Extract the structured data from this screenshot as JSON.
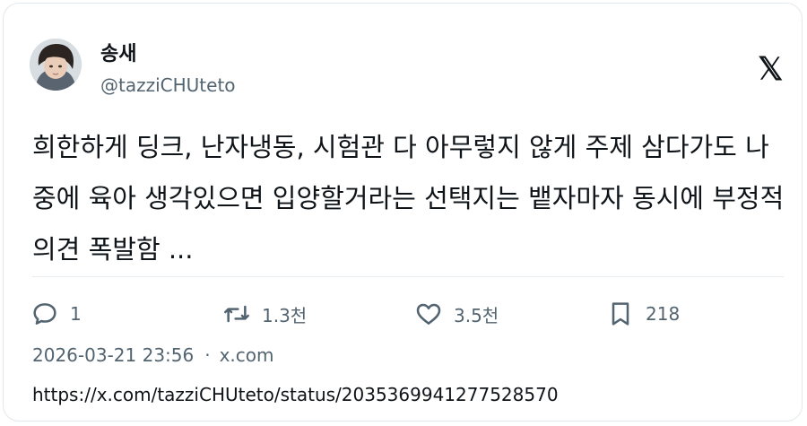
{
  "author": {
    "display_name": "송새",
    "handle": "@tazziCHUteto"
  },
  "tweet": {
    "text": "희한하게 딩크, 난자냉동, 시험관 다 아무렇지 않게 주제 삼다가도 나중에 육아 생각있으면 입양할거라는 선택지는 뱉자마자 동시에 부정적 의견 폭발함 ..."
  },
  "actions": {
    "replies": "1",
    "retweets": "1.3천",
    "likes": "3.5천",
    "bookmarks": "218"
  },
  "meta": {
    "timestamp": "2026-03-21 23:56",
    "separator": "·",
    "source": "x.com"
  },
  "status_url": "https://x.com/tazziCHUteto/status/2035369941277528570",
  "icons": {
    "logo": "x-logo-icon",
    "reply": "reply-bubble-icon",
    "retweet": "retweet-icon",
    "like": "heart-icon",
    "bookmark": "bookmark-icon"
  },
  "colors": {
    "text": "#0f1419",
    "secondary": "#536471",
    "border": "#e1e8ed"
  }
}
